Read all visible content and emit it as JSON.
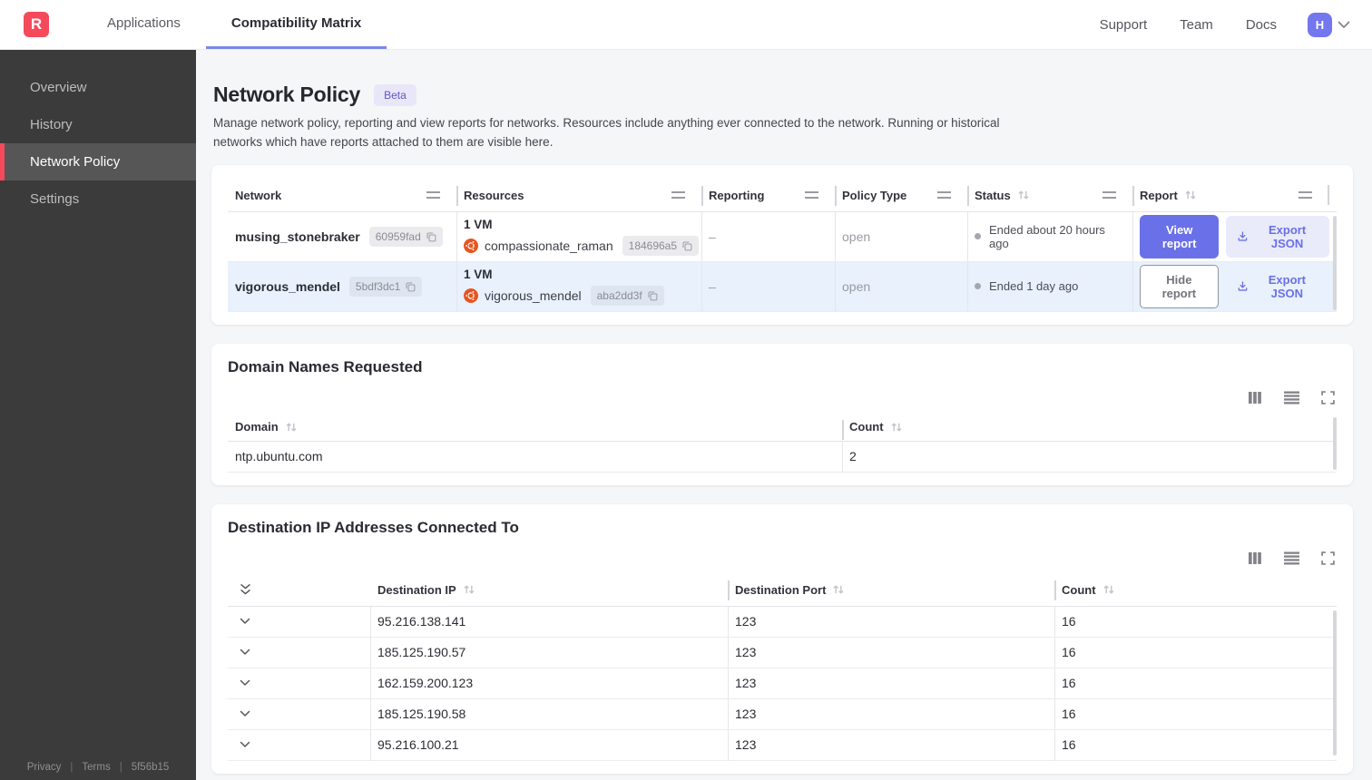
{
  "topnav": {
    "logo_letter": "R",
    "tabs": [
      {
        "label": "Applications"
      },
      {
        "label": "Compatibility Matrix"
      }
    ],
    "links": {
      "support": "Support",
      "team": "Team",
      "docs": "Docs"
    },
    "avatar_initial": "H"
  },
  "sidebar": {
    "items": [
      {
        "label": "Overview"
      },
      {
        "label": "History"
      },
      {
        "label": "Network Policy"
      },
      {
        "label": "Settings"
      }
    ],
    "footer": {
      "privacy": "Privacy",
      "terms": "Terms",
      "version": "5f56b15"
    }
  },
  "page": {
    "title": "Network Policy",
    "beta_badge": "Beta",
    "description": "Manage network policy, reporting and view reports for networks. Resources include anything ever connected to the network. Running or historical networks which have reports attached to them are visible here."
  },
  "networks_table": {
    "columns": [
      "Network",
      "Resources",
      "Reporting",
      "Policy Type",
      "Status",
      "Report"
    ],
    "rows": [
      {
        "network_name": "musing_stonebraker",
        "network_id": "60959fad",
        "resources_count": "1 VM",
        "vm_name": "compassionate_raman",
        "vm_id": "184696a5",
        "reporting": "–",
        "policy_type": "open",
        "status": "Ended about 20 hours ago",
        "report_button": "View report",
        "export_button": "Export JSON"
      },
      {
        "network_name": "vigorous_mendel",
        "network_id": "5bdf3dc1",
        "resources_count": "1 VM",
        "vm_name": "vigorous_mendel",
        "vm_id": "aba2dd3f",
        "reporting": "–",
        "policy_type": "open",
        "status": "Ended 1 day ago",
        "report_button": "Hide report",
        "export_button": "Export JSON"
      }
    ]
  },
  "domains_section": {
    "title": "Domain Names Requested",
    "columns": [
      "Domain",
      "Count"
    ],
    "rows": [
      {
        "domain": "ntp.ubuntu.com",
        "count": "2"
      }
    ]
  },
  "destinations_section": {
    "title": "Destination IP Addresses Connected To",
    "columns": [
      "Destination IP",
      "Destination Port",
      "Count"
    ],
    "rows": [
      {
        "ip": "95.216.138.141",
        "port": "123",
        "count": "16"
      },
      {
        "ip": "185.125.190.57",
        "port": "123",
        "count": "16"
      },
      {
        "ip": "162.159.200.123",
        "port": "123",
        "count": "16"
      },
      {
        "ip": "185.125.190.58",
        "port": "123",
        "count": "16"
      },
      {
        "ip": "95.216.100.21",
        "port": "123",
        "count": "16"
      }
    ]
  },
  "colors": {
    "accent_red": "#f44a5c",
    "accent_purple": "#6a70e7",
    "row_highlight": "#e8f1fc",
    "ubuntu_orange": "#e95420"
  }
}
